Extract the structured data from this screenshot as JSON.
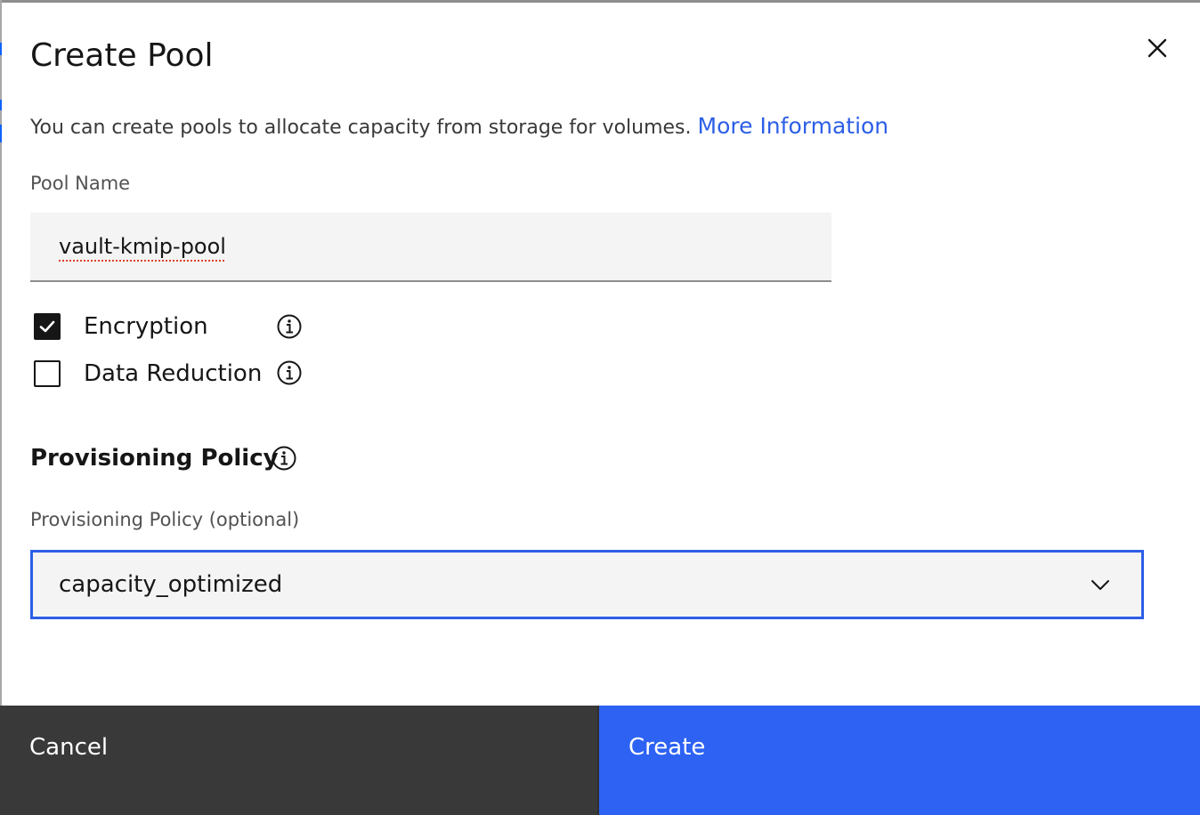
{
  "dialog": {
    "title": "Create Pool",
    "description": "You can create pools to allocate capacity from storage for volumes.",
    "more_info_link": "More Information"
  },
  "pool_name": {
    "label": "Pool Name",
    "value": "vault-kmip-pool"
  },
  "options": {
    "encryption": {
      "label": "Encryption",
      "checked": true
    },
    "data_reduction": {
      "label": "Data Reduction",
      "checked": false
    }
  },
  "provisioning": {
    "section_title": "Provisioning Policy",
    "field_label": "Provisioning Policy (optional)",
    "selected": "capacity_optimized"
  },
  "footer": {
    "cancel_label": "Cancel",
    "create_label": "Create"
  },
  "icons": {
    "close": "close-icon",
    "info": "info-icon",
    "checkmark": "checkmark-icon",
    "chevron": "chevron-down-icon"
  },
  "colors": {
    "primary": "#2d62f3",
    "link": "#2d5fe6",
    "secondary_button": "#393939",
    "field_bg": "#f4f4f4"
  }
}
